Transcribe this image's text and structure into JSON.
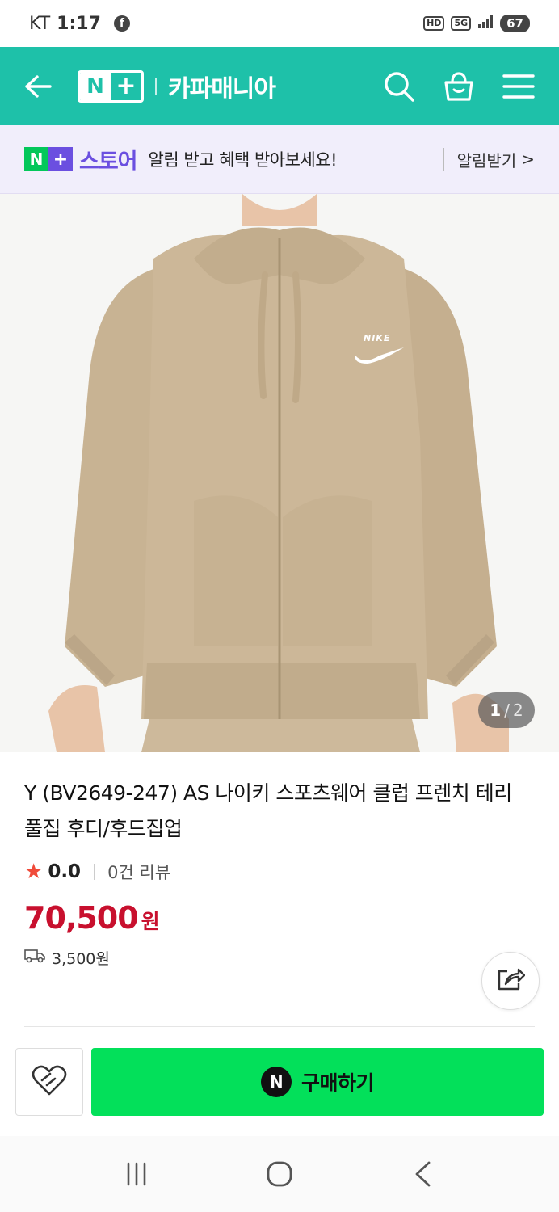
{
  "status_bar": {
    "carrier": "KT",
    "time": "1:17",
    "app_badge": "f",
    "hd": "HD",
    "network": "5G",
    "battery": "67"
  },
  "header": {
    "logo_n": "N",
    "logo_plus": "+",
    "store_name": "카파매니아",
    "icons": [
      "back-arrow-icon",
      "search-icon",
      "shopping-bag-icon",
      "menu-icon"
    ],
    "bg_color": "#1ec1a9"
  },
  "promo": {
    "logo_n": "N",
    "logo_plus": "+",
    "store_label": "스토어",
    "message": "알림 받고 혜택 받아보세요!",
    "action": "알림받기",
    "action_chevron": ">",
    "accent": "#6b4fe0"
  },
  "product": {
    "image_index": "1",
    "image_separator": "/",
    "image_total": "2",
    "brand_mark": "NIKE",
    "title": "Y (BV2649-247) AS 나이키 스포츠웨어 클럽 프렌치 테리 풀집 후디/후드집업",
    "rating_star": "★",
    "rating": "0.0",
    "reviews": "0건 리뷰",
    "price": "70,500",
    "currency": "원",
    "shipping_fee": "3,500원",
    "price_color": "#c8102e"
  },
  "actions": {
    "wish_icon": "heart-icon",
    "share_icon": "share-icon",
    "buy_badge": "N",
    "buy_label": "구매하기",
    "buy_color": "#03e05a"
  },
  "nav": {
    "icons": [
      "recent-apps-icon",
      "home-icon",
      "back-icon"
    ]
  }
}
